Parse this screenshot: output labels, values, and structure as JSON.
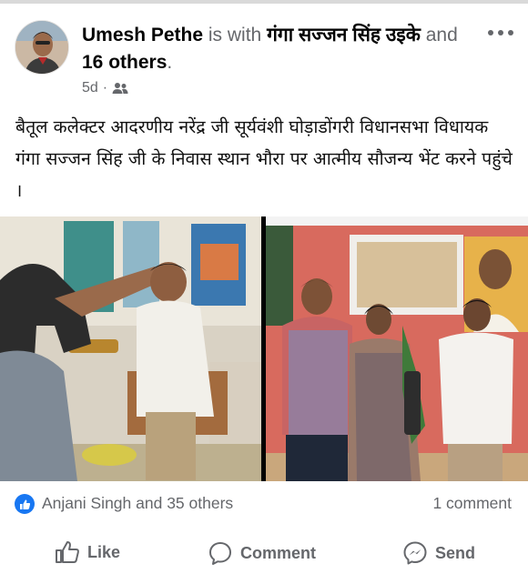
{
  "post": {
    "author": "Umesh Pethe",
    "with_word": "is with",
    "tagged": "गंगा सज्जन सिंह उइके",
    "and_word": "and",
    "others": "16 others",
    "period": ".",
    "time": "5d",
    "separator": "·",
    "audience_icon": "friends-icon",
    "text": "बैतूल कलेक्टर आदरणीय नरेंद्र जी सूर्यवंशी घोड़ाडोंगरी विधानसभा विधायक गंगा सज्जन सिंह जी के निवास स्थान भौरा पर आत्मीय सौजन्य भेंट करने पहुंचे ।"
  },
  "stats": {
    "reactors": "Anjani Singh and 35 others",
    "comments": "1 comment"
  },
  "actions": {
    "like": "Like",
    "comment": "Comment",
    "send": "Send"
  },
  "colors": {
    "accent": "#1877f2",
    "muted": "#65676b"
  }
}
